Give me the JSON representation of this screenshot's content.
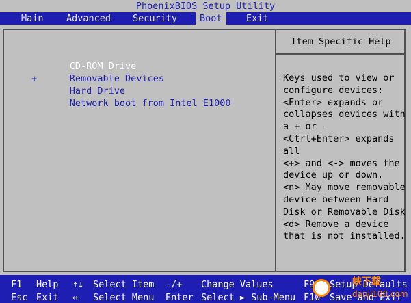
{
  "title": "PhoenixBIOS Setup Utility",
  "menu": [
    {
      "label": "Main",
      "active": false
    },
    {
      "label": "Advanced",
      "active": false
    },
    {
      "label": "Security",
      "active": false
    },
    {
      "label": "Boot",
      "active": true
    },
    {
      "label": "Exit",
      "active": false
    }
  ],
  "boot_order": [
    {
      "label": "CD-ROM Drive",
      "selected": true
    },
    {
      "label": "Removable Devices",
      "selected": false
    },
    {
      "label": "Hard Drive",
      "selected": false,
      "marker": "+"
    },
    {
      "label": "Network boot from Intel E1000",
      "selected": false
    }
  ],
  "help": {
    "title": "Item Specific Help",
    "lines": [
      "Keys used to view or",
      "configure devices:",
      "<Enter> expands or",
      "collapses devices with",
      "a + or -",
      "<Ctrl+Enter> expands",
      "all",
      "<+> and <-> moves the",
      "device up or down.",
      "<n> May move removable",
      "device between Hard",
      "Disk or Removable Disk",
      "<d> Remove a device",
      "that is not installed."
    ]
  },
  "footer": {
    "row1": [
      {
        "key": "F1",
        "desc": "Help"
      },
      {
        "key": "↑↓",
        "desc": "Select Item"
      },
      {
        "key": "-/+",
        "desc": "Change Values"
      },
      {
        "key": "F9",
        "desc": "Setup Defaults"
      }
    ],
    "row2": [
      {
        "key": "Esc",
        "desc": "Exit"
      },
      {
        "key": "↔",
        "desc": "Select Menu"
      },
      {
        "key": "Enter",
        "desc": "Select ► Sub-Menu"
      },
      {
        "key": "F10",
        "desc": "Save and Exit"
      }
    ]
  },
  "watermark": {
    "line1": "峡下载",
    "line2": "danji100.com"
  },
  "colors": {
    "bios_blue": "#1e1eb2",
    "bios_gray": "#c0c0c0",
    "watermark_orange": "#ff8a00"
  }
}
